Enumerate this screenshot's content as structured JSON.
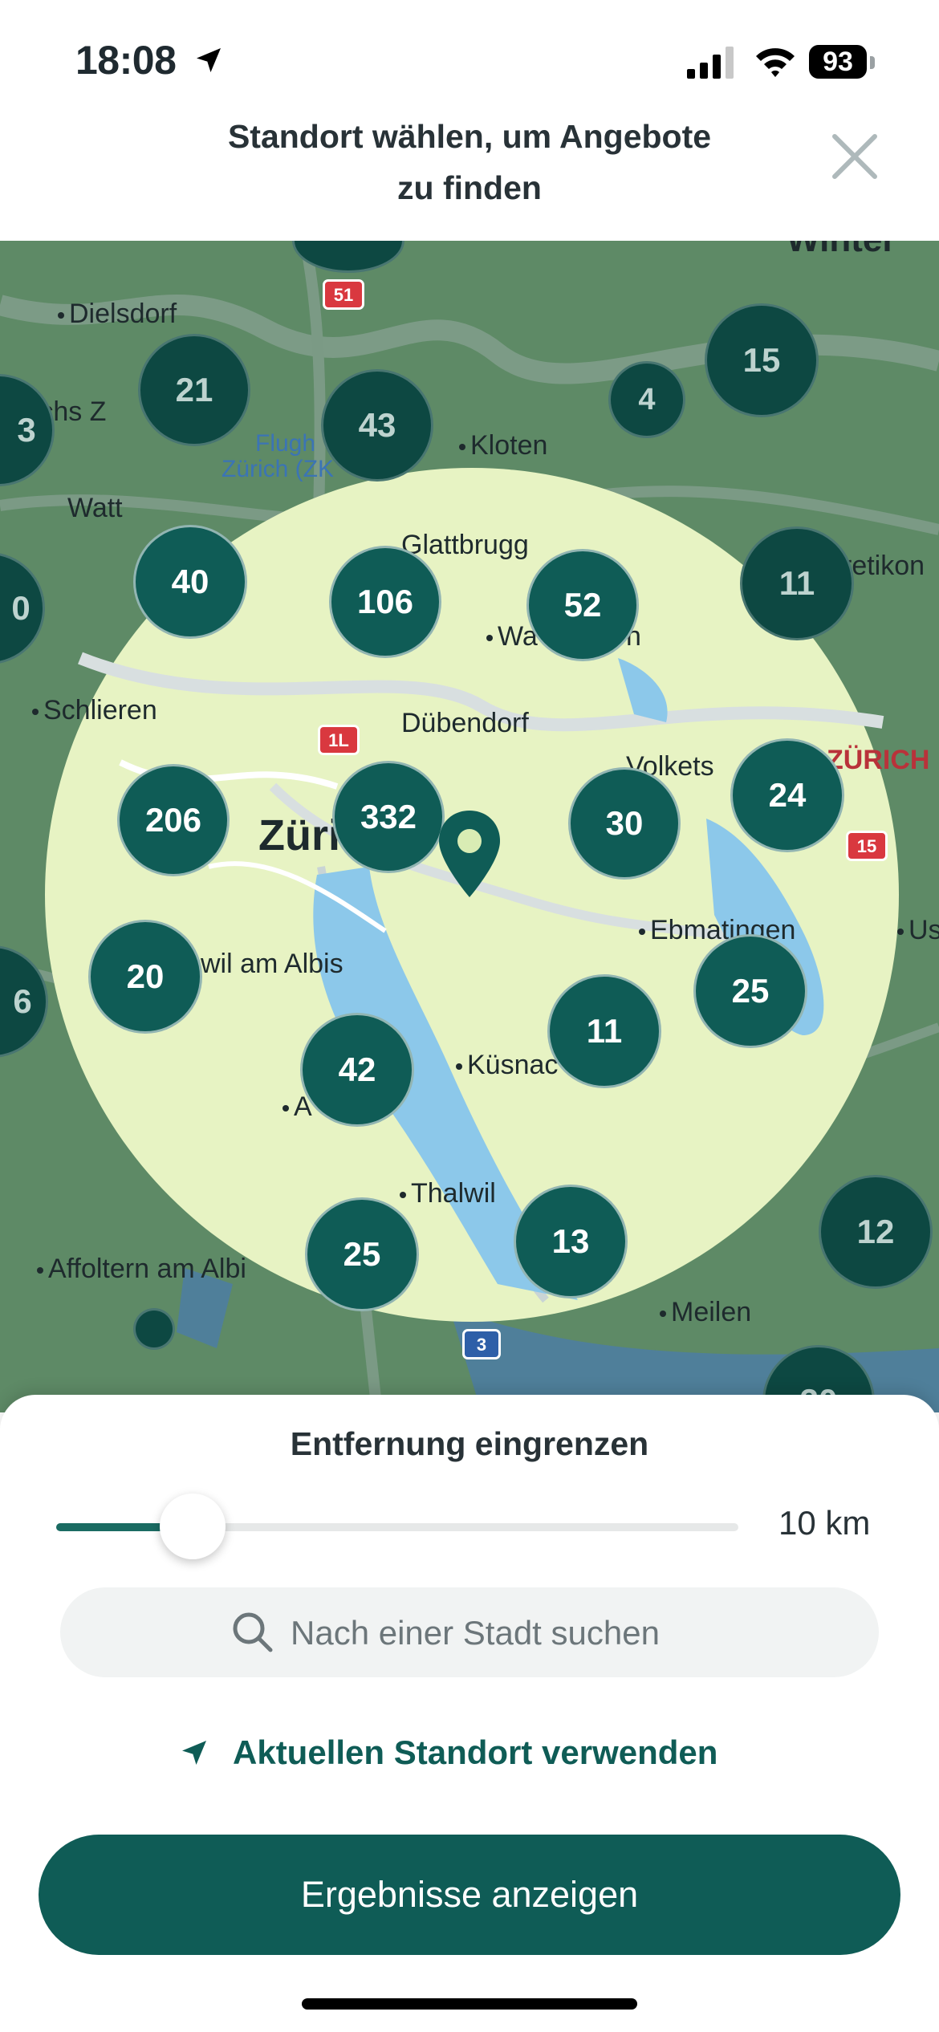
{
  "status_bar": {
    "time": "18:08",
    "battery": "93"
  },
  "header": {
    "title_line1": "Standort wählen, um Angebote",
    "title_line2": "zu finden"
  },
  "map": {
    "places": {
      "dielsdorf": "Dielsdorf",
      "kloten": "Kloten",
      "flughafen1": "Flugh",
      "flughafen2": "Zürich (ZK",
      "watt": "Watt",
      "glattbrugg": "Glattbrugg",
      "wallisellen_a": "Wa",
      "wallisellen_b": "n",
      "schlieren": "Schlieren",
      "dubendorf": "Dübendorf",
      "volketswil": "Volkets",
      "zurich_city": "Züri",
      "zurich_canton": "ZÜRICH",
      "ebmatingen": "Ebmatingen",
      "adliswil": "wil am Albis",
      "kusnacht": "Küsnac",
      "au": "A",
      "thalwil": "Thalwil",
      "affoltern": "Affoltern am Albi",
      "meilen": "Meilen",
      "wintert": "Winter",
      "pfaffikon": "retikon",
      "us": "Us",
      "rchs": "rchs Z"
    },
    "road_shields": {
      "a51": "51",
      "a1l": "1L",
      "a15": "15",
      "a3": "3"
    },
    "clusters": [
      "21",
      "43",
      "15",
      "4",
      "40",
      "106",
      "52",
      "11",
      "206",
      "332",
      "30",
      "24",
      "20",
      "25",
      "42",
      "11",
      "25",
      "13",
      "12",
      "3",
      "0",
      "6",
      "30"
    ]
  },
  "sheet": {
    "title": "Entfernung eingrenzen",
    "slider_value_label": "10 km",
    "slider_fraction": 0.2,
    "search_placeholder": "Nach einer Stadt suchen",
    "use_location_label": "Aktuellen Standort verwenden",
    "results_button": "Ergebnisse anzeigen"
  },
  "colors": {
    "brand": "#0f5c56",
    "map_green": "#5e8a66",
    "radius_fill": "#e7f3c3"
  }
}
